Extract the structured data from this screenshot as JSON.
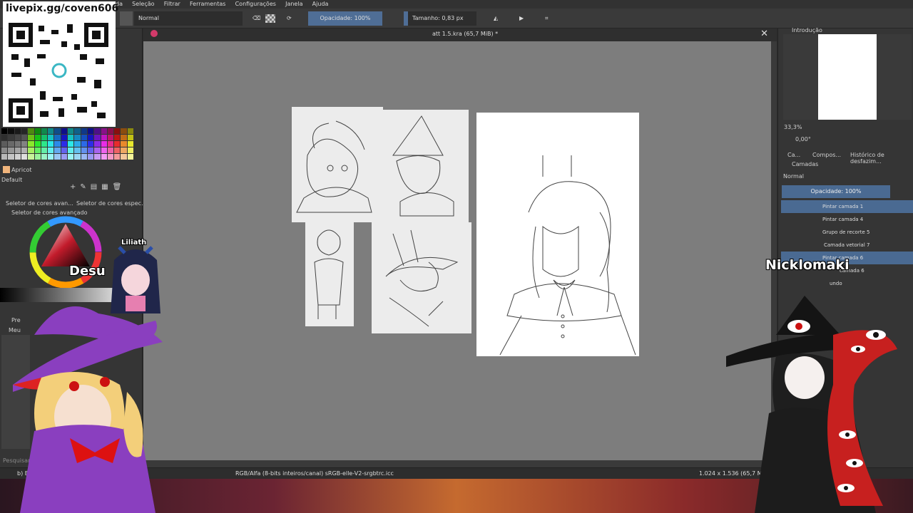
{
  "menu": {
    "items": [
      "da",
      "Seleção",
      "Filtrar",
      "Ferramentas",
      "Configurações",
      "Janela",
      "Ajuda"
    ]
  },
  "toolbar": {
    "blend_mode": "Normal",
    "opacity_label": "Opacidade: 100%",
    "size_label": "Tamanho: 0,83 px"
  },
  "document": {
    "title": "att 1.5.kra (65,7 MiB) *"
  },
  "left_dock": {
    "palette_name": "Apricot",
    "palette_set": "Default",
    "tab_advanced": "Seletor de cores avan...",
    "tab_specific": "Seletor de cores espec...",
    "advanced_title": "Seletor de cores avançado",
    "presets_label": "Pre",
    "presets_tag": "Meu",
    "search_placeholder": "Pesquisar",
    "brush_preset": "b) Basic-"
  },
  "overview": {
    "title": "Introdução",
    "zoom": "33,3%",
    "rotation": "0,00°"
  },
  "tabs": {
    "tab1": "Ca...",
    "tab2": "Compos...",
    "tab3": "Histórico de desfazim..."
  },
  "layers": {
    "title": "Camadas",
    "blend_mode": "Normal",
    "opacity_label": "Opacidade: 100%",
    "items": [
      {
        "name": "Pintar camada 1",
        "selected": true
      },
      {
        "name": "Pintar camada 4",
        "selected": false
      },
      {
        "name": "Grupo de recorte 5",
        "selected": false
      },
      {
        "name": "Camada vetorial 7",
        "selected": false
      },
      {
        "name": "Pintar camada 6",
        "selected": true
      },
      {
        "name": "camada 6",
        "selected": false
      },
      {
        "name": "undo",
        "selected": false
      }
    ]
  },
  "status": {
    "color_space": "RGB/Alfa (8-bits inteiros/canal)  sRGB-elle-V2-srgbtrc.icc",
    "dimensions": "1.024 x 1.536 (65,7 MiB)"
  },
  "overlay": {
    "qr_url": "livepix.gg/coven606",
    "name_left_small": "Liliath",
    "name_left_big": "Desu",
    "name_right": "Nicklomaki"
  },
  "colors": {
    "toolbar_highlight": "#4f6e96",
    "layer_selected": "#4a6a92",
    "canvas_bg": "#7d7d7d"
  }
}
